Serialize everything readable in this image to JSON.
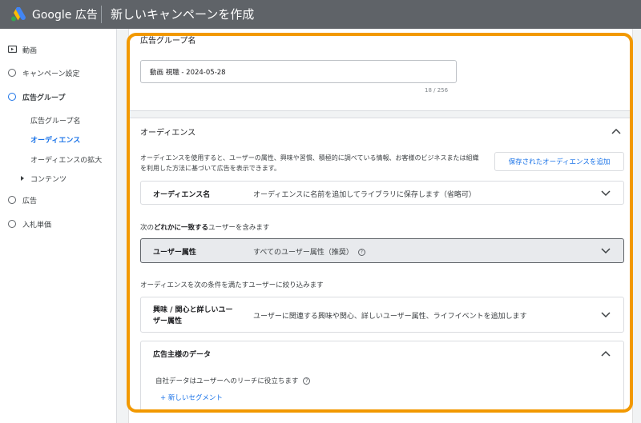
{
  "header": {
    "brand": "Google 広告",
    "page_title": "新しいキャンペーンを作成"
  },
  "sidebar": {
    "items": [
      {
        "label": "動画",
        "icon": "video-icon"
      },
      {
        "label": "キャンペーン設定"
      },
      {
        "label": "広告グループ"
      },
      {
        "label": "広告"
      },
      {
        "label": "入札単価"
      }
    ],
    "sub_items": [
      {
        "label": "広告グループ名"
      },
      {
        "label": "オーディエンス"
      },
      {
        "label": "オーディエンスの拡大"
      },
      {
        "label": "コンテンツ"
      }
    ]
  },
  "ad_group": {
    "label": "広告グループ名",
    "value": "動画 視聴 - 2024-05-28",
    "char_count": "18 / 256"
  },
  "audience": {
    "title": "オーディエンス",
    "description": "オーディエンスを使用すると、ユーザーの属性、興味や習慣、積極的に調べている情報、お客様のビジネスまたは組織を利用した方法に基づいて広告を表示できます。",
    "saved_button": "保存されたオーディエンスを追加",
    "name_row": {
      "label": "オーディエンス名",
      "value": "オーディエンスに名前を追加してライブラリに保存します（省略可）"
    },
    "match_prefix": "次の",
    "match_bold": "どれかに一致する",
    "match_suffix": "ユーザーを含みます",
    "demographics_row": {
      "label": "ユーザー属性",
      "value": "すべてのユーザー属性（推奨）",
      "help": "?"
    },
    "narrow_text": "オーディエンスを次の条件を満たすユーザーに絞り込みます",
    "interests_row": {
      "label_line1": "興味 / 関心と詳しいユー",
      "label_line2": "ザー属性",
      "value": "ユーザーに関連する興味や関心、詳しいユーザー属性、ライフイベントを追加します"
    },
    "advertiser_data": {
      "title": "広告主様のデータ",
      "note": "自社データはユーザーへのリーチに役立ちます",
      "help": "?",
      "new_segment": "+ 新しいセグメント"
    }
  },
  "colors": {
    "topbar": "#5f6368",
    "accent": "#1a73e8",
    "highlight": "#f29900"
  }
}
